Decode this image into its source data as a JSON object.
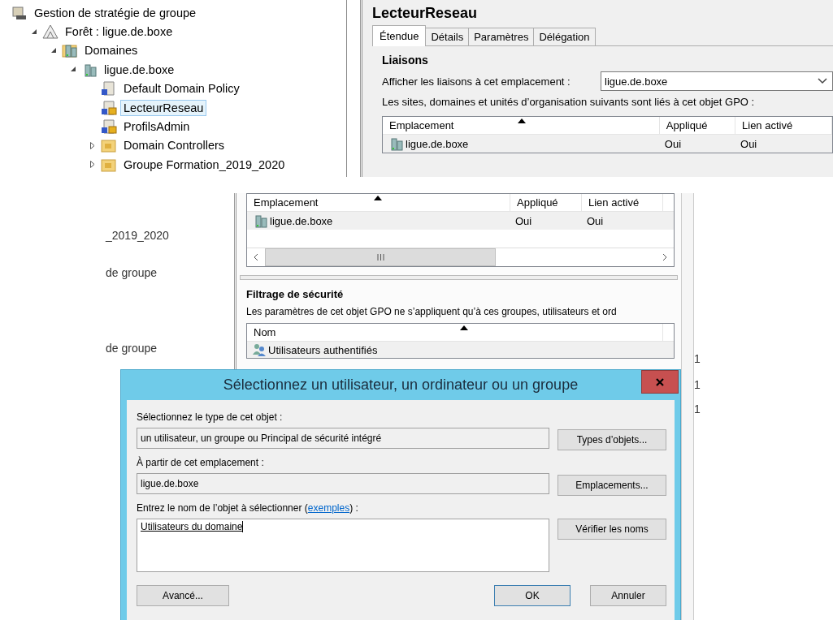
{
  "tree": {
    "items": [
      {
        "label": "Gestion de stratégie de groupe",
        "kind": "console",
        "selected": false,
        "children": [
          {
            "label": "Forêt : ligue.de.boxe",
            "kind": "forest",
            "expanded": true,
            "selected": false,
            "children": [
              {
                "label": "Domaines",
                "kind": "domains",
                "expanded": true,
                "selected": false,
                "children": [
                  {
                    "label": "ligue.de.boxe",
                    "kind": "domain",
                    "expanded": true,
                    "selected": false,
                    "children": [
                      {
                        "label": "Default Domain Policy",
                        "kind": "gpo",
                        "selected": false
                      },
                      {
                        "label": "LecteurReseau",
                        "kind": "gpo-locked",
                        "selected": true
                      },
                      {
                        "label": "ProfilsAdmin",
                        "kind": "gpo-locked",
                        "selected": false
                      },
                      {
                        "label": "Domain Controllers",
                        "kind": "ou",
                        "expanded": false,
                        "selected": false
                      },
                      {
                        "label": "Groupe Formation_2019_2020",
                        "kind": "ou",
                        "expanded": false,
                        "selected": false
                      }
                    ]
                  }
                ]
              }
            ]
          }
        ]
      }
    ]
  },
  "gpo_panel": {
    "title": "LecteurReseau",
    "tabs": [
      {
        "label": "Étendue",
        "selected": true
      },
      {
        "label": "Détails",
        "selected": false
      },
      {
        "label": "Paramètres",
        "selected": false
      },
      {
        "label": "Délégation",
        "selected": false
      }
    ],
    "section": "Liaisons",
    "location_label": "Afficher les liaisons à cet emplacement :",
    "location_value": "ligue.de.boxe",
    "links_text": "Les sites, domaines et unités d’organisation suivants sont liés à cet objet GPO :",
    "links_table": {
      "columns": [
        "Emplacement",
        "Appliqué",
        "Lien activé"
      ],
      "rows": [
        [
          "ligue.de.boxe",
          "Oui",
          "Oui"
        ]
      ]
    }
  },
  "lower_view": {
    "left_fragments": [
      "_2019_2020",
      "de groupe",
      "de groupe"
    ],
    "links_table": {
      "columns": [
        "Emplacement",
        "Appliqué",
        "Lien activé"
      ],
      "rows": [
        [
          "ligue.de.boxe",
          "Oui",
          "Oui"
        ]
      ]
    },
    "security_title": "Filtrage de sécurité",
    "security_text": "Les paramètres de cet objet GPO ne s’appliquent qu’à ces groupes, utilisateurs et ord",
    "security_table": {
      "columns": [
        "Nom"
      ],
      "rows": [
        [
          "Utilisateurs authentifiés"
        ]
      ]
    },
    "right_fragments": [
      "1",
      "1",
      "1"
    ]
  },
  "dialog": {
    "title": "Sélectionnez un utilisateur, un ordinateur ou un groupe",
    "type_label": "Sélectionnez le type de cet objet :",
    "type_value": "un utilisateur, un groupe ou Principal de sécurité intégré",
    "type_button": "Types d’objets...",
    "location_label": "À partir de cet emplacement :",
    "location_value": "ligue.de.boxe",
    "location_button": "Emplacements...",
    "name_label": {
      "before": "Entrez le nom de l’objet à sélectionner (",
      "link": "exemples",
      "after": ") :"
    },
    "name_value": "Utilisateurs du domaine",
    "check_button": "Vérifier les noms",
    "buttons": [
      {
        "label": "Avancé...",
        "kind": "advanced"
      },
      {
        "label": "OK",
        "kind": "default"
      },
      {
        "label": "Annuler",
        "kind": "cancel"
      }
    ]
  }
}
